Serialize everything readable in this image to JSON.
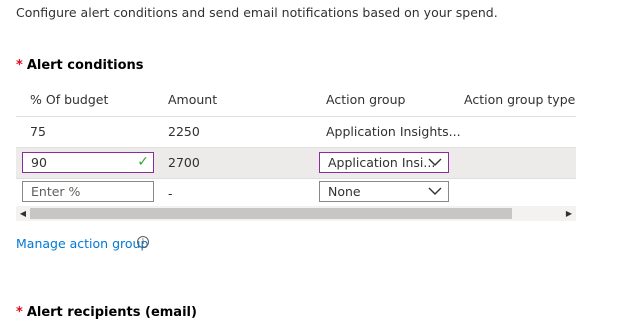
{
  "intro": {
    "text": "Configure alert conditions and send email notifications based on your spend."
  },
  "alert_conditions": {
    "required_marker": "*",
    "title": "Alert conditions",
    "columns": [
      "% Of budget",
      "Amount",
      "Action group",
      "Action group type"
    ],
    "rows": [
      {
        "percent": "75",
        "amount": "2250",
        "action_group": "Application Insights..."
      },
      {
        "percent": "90",
        "amount": "2700",
        "action_group": "Application Insi..."
      },
      {
        "percent_placeholder": "Enter %",
        "amount": "-",
        "action_group": "None"
      }
    ]
  },
  "manage_link": {
    "label": "Manage action group",
    "info_icon": "info-icon"
  },
  "alert_recipients": {
    "required_marker": "*",
    "title": "Alert recipients (email)"
  },
  "colors": {
    "accent_border": "#8a2d9c",
    "link": "#0078d4",
    "required": "#e00b1c",
    "valid": "#2ea82e"
  }
}
